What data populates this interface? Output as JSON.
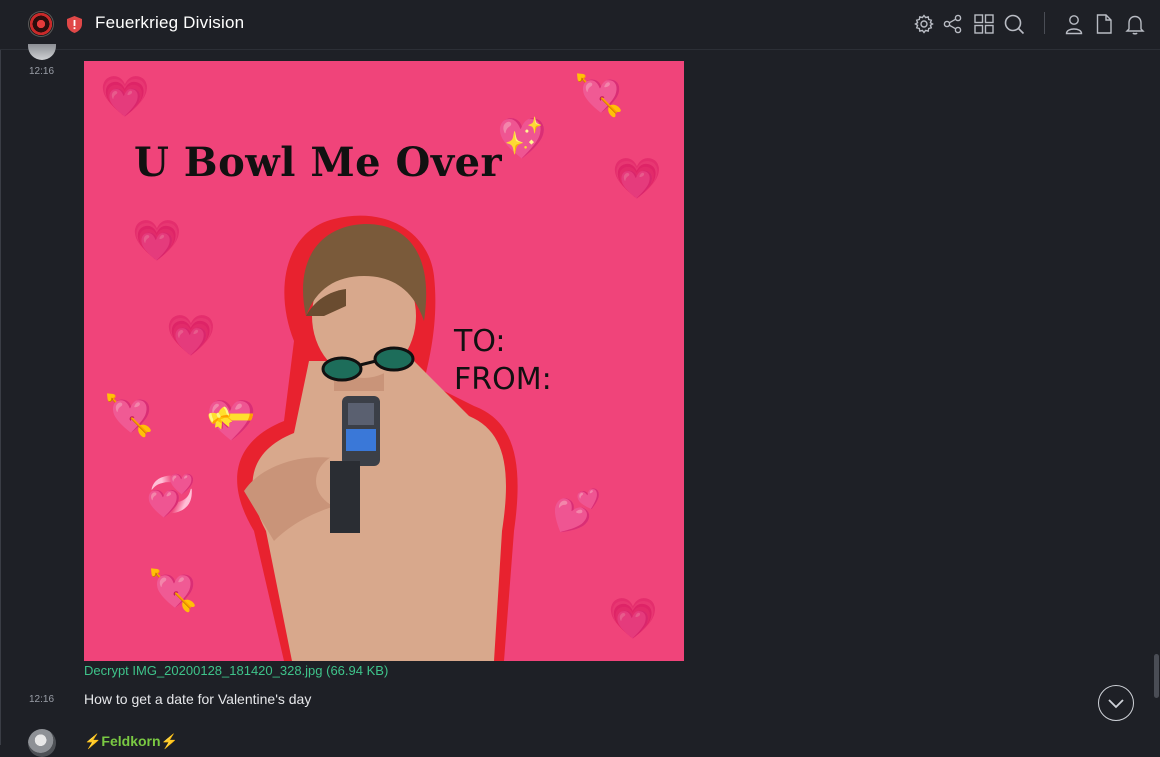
{
  "header": {
    "room_name": "Feuerkrieg Division",
    "icons": [
      "settings-icon",
      "share-icon",
      "apps-grid-icon",
      "search-icon",
      "user-icon",
      "files-icon",
      "notifications-icon"
    ]
  },
  "timeline": {
    "image_message": {
      "timestamp": "12:16",
      "card_title": "U Bowl Me Over",
      "card_to": "TO:",
      "card_from": "FROM:",
      "file_link": "Decrypt IMG_20200128_181420_328.jpg (66.94 KB)"
    },
    "text_message": {
      "timestamp": "12:16",
      "text": "How to get a date for Valentine's day"
    },
    "next_sender": {
      "name": "⚡Feldkorn⚡"
    }
  },
  "colors": {
    "background": "#1e2026",
    "card_pink": "#f0447a",
    "link_green": "#3ec38a",
    "sender_green": "#7ac943"
  }
}
